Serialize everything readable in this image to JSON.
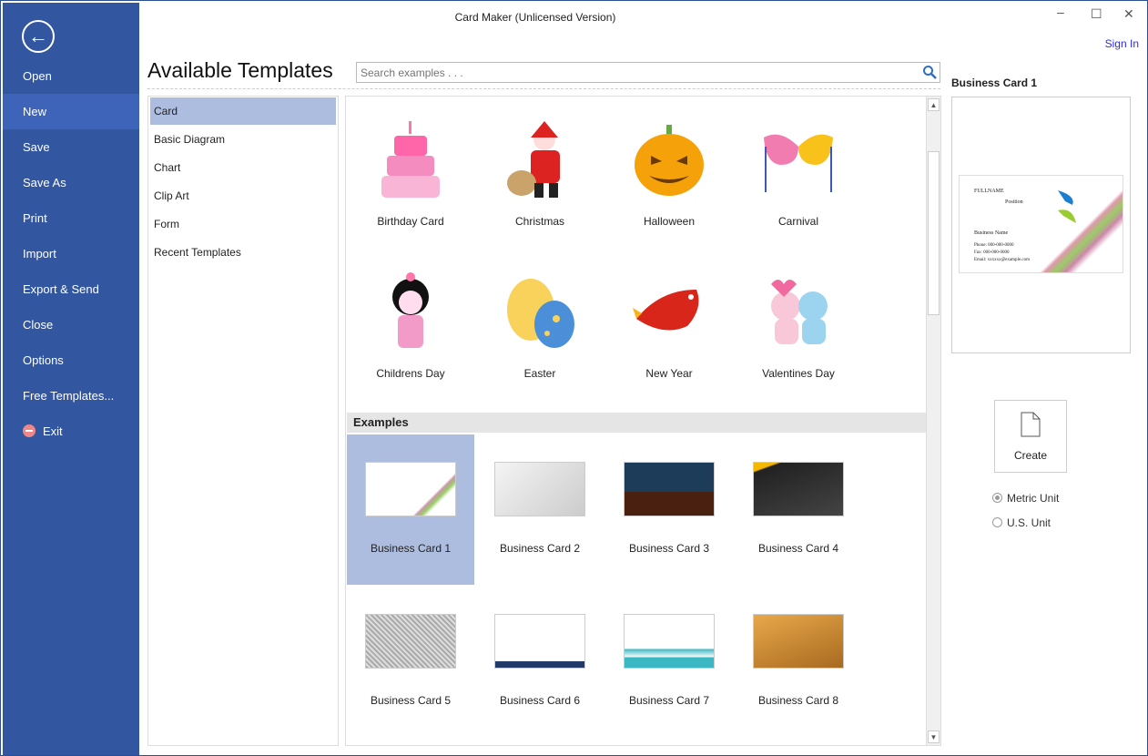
{
  "window": {
    "title": "Card Maker (Unlicensed Version)",
    "sign_in": "Sign In"
  },
  "sidebar": {
    "items": [
      {
        "label": "Open"
      },
      {
        "label": "New"
      },
      {
        "label": "Save"
      },
      {
        "label": "Save As"
      },
      {
        "label": "Print"
      },
      {
        "label": "Import"
      },
      {
        "label": "Export & Send"
      },
      {
        "label": "Close"
      },
      {
        "label": "Options"
      },
      {
        "label": "Free Templates..."
      },
      {
        "label": "Exit"
      }
    ]
  },
  "main": {
    "heading": "Available Templates",
    "search_placeholder": "Search examples . . .",
    "categories": [
      "Card",
      "Basic Diagram",
      "Chart",
      "Clip Art",
      "Form",
      "Recent Templates"
    ],
    "templates": [
      "Birthday Card",
      "Christmas",
      "Halloween",
      "Carnival",
      "Childrens Day",
      "Easter",
      "New Year",
      "Valentines Day"
    ],
    "examples_header": "Examples",
    "examples": [
      "Business Card 1",
      "Business Card 2",
      "Business Card 3",
      "Business Card 4",
      "Business Card 5",
      "Business Card 6",
      "Business Card 7",
      "Business Card 8"
    ]
  },
  "preview": {
    "title": "Business Card 1",
    "card_text": {
      "name": "FULLNAME",
      "position": "Position",
      "business": "Business Name",
      "phone": "Phone: 000-000-0000",
      "fax": "Fax: 000-000-0000",
      "email": "Email: xxxxxx@example.com"
    },
    "create": "Create",
    "units": [
      {
        "label": "Metric Unit",
        "selected": true
      },
      {
        "label": "U.S. Unit",
        "selected": false
      }
    ]
  }
}
